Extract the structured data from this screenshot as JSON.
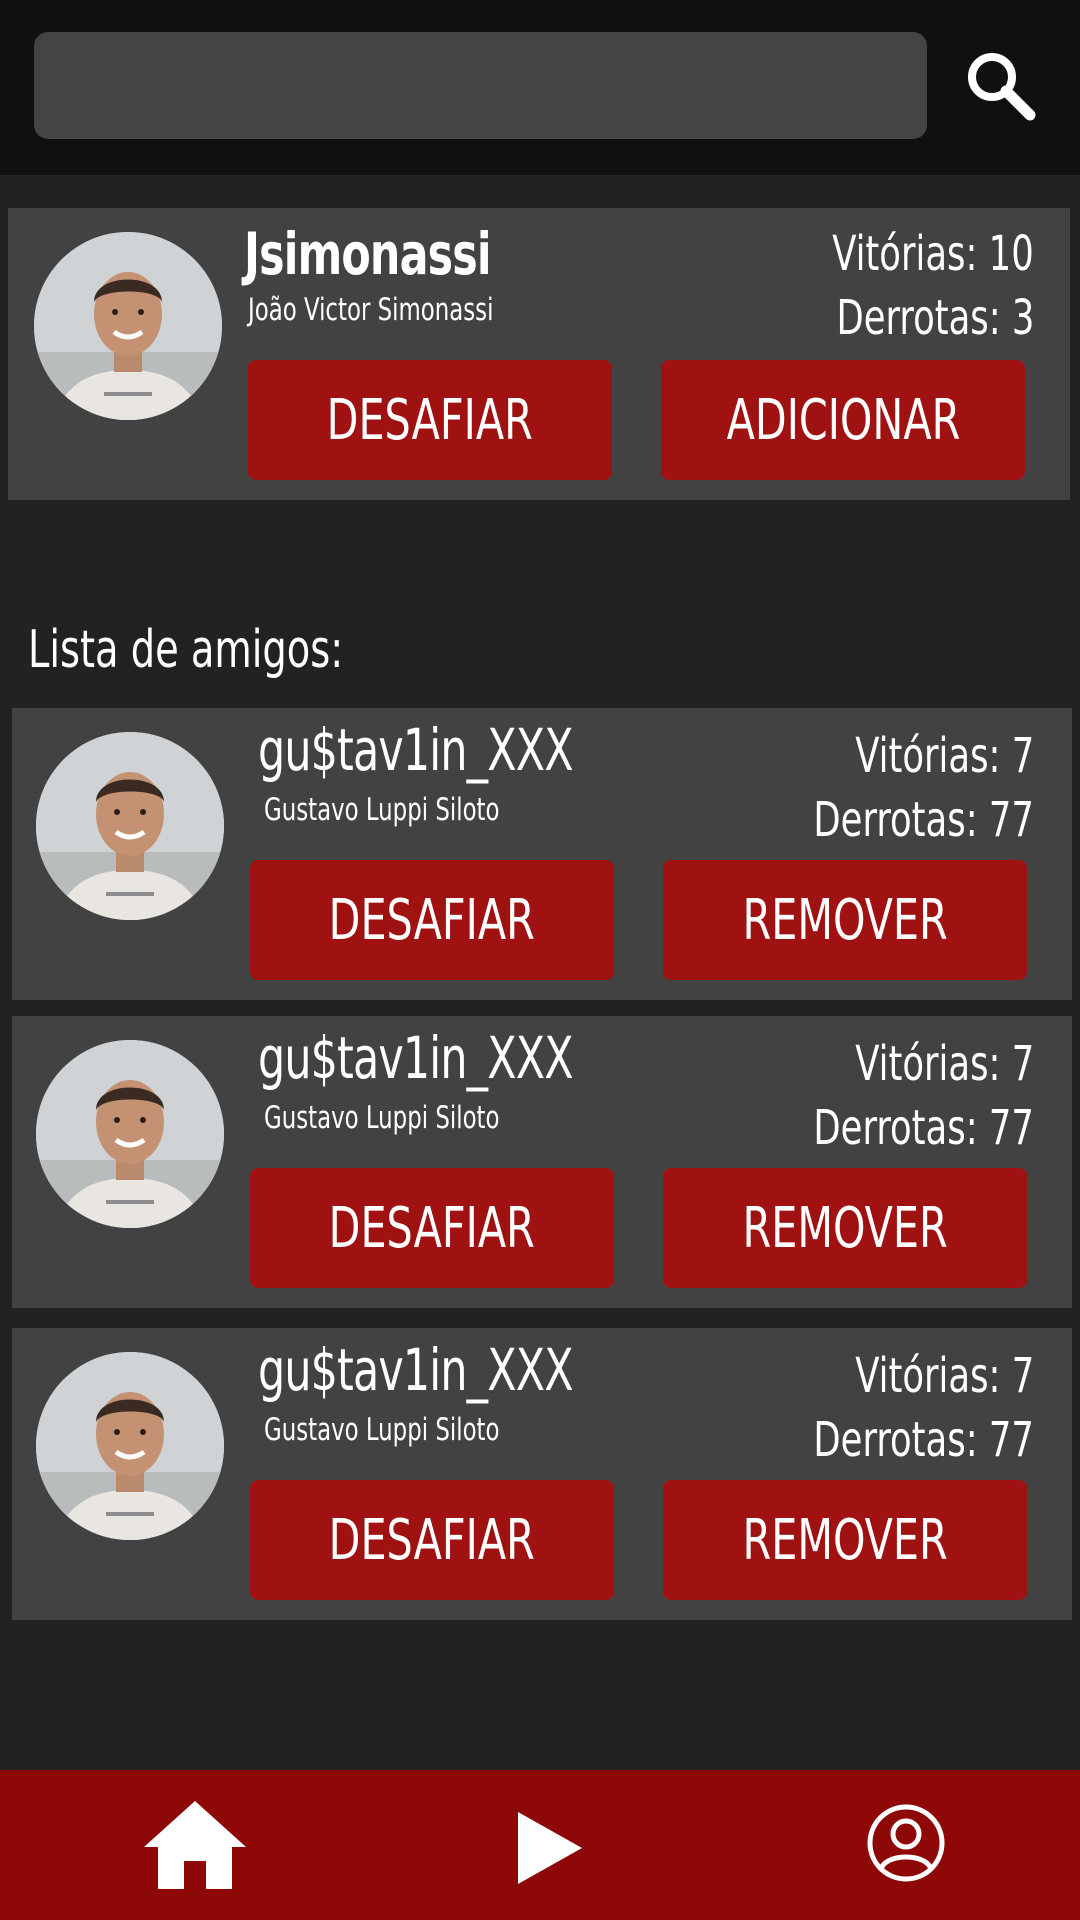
{
  "search": {
    "placeholder": "",
    "value": ""
  },
  "icons": {
    "search": "search-icon",
    "home": "home-icon",
    "play": "play-icon",
    "profile": "user-icon"
  },
  "colors": {
    "background": "#222222",
    "topbar": "#101010",
    "card": "#424242",
    "button": "#a01212",
    "nav": "#8e0808",
    "text": "#ffffff"
  },
  "search_result": {
    "username": "Jsimonassi",
    "fullname": "João Victor Simonassi",
    "wins": "Vitórias: 10",
    "losses": "Derrotas: 3",
    "challenge_label": "DESAFIAR",
    "add_label": "ADICIONAR"
  },
  "friends": {
    "title": "Lista de amigos:",
    "items": [
      {
        "username": "gu$tav1in_XXX",
        "fullname": "Gustavo Luppi Siloto",
        "wins": "Vitórias: 7",
        "losses": "Derrotas: 77",
        "challenge_label": "DESAFIAR",
        "remove_label": "REMOVER"
      },
      {
        "username": "gu$tav1in_XXX",
        "fullname": "Gustavo Luppi Siloto",
        "wins": "Vitórias: 7",
        "losses": "Derrotas: 77",
        "challenge_label": "DESAFIAR",
        "remove_label": "REMOVER"
      },
      {
        "username": "gu$tav1in_XXX",
        "fullname": "Gustavo Luppi Siloto",
        "wins": "Vitórias: 7",
        "losses": "Derrotas: 77",
        "challenge_label": "DESAFIAR",
        "remove_label": "REMOVER"
      }
    ]
  }
}
